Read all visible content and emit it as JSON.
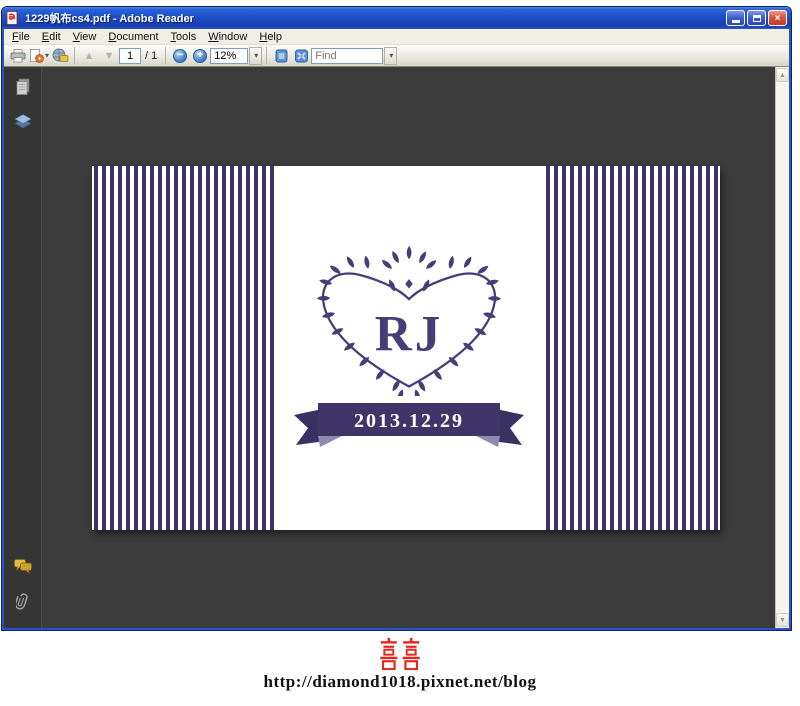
{
  "window": {
    "title": "1229帆布cs4.pdf - Adobe Reader",
    "controls": {
      "close_glyph": "×"
    }
  },
  "menu": {
    "items": [
      "File",
      "Edit",
      "View",
      "Document",
      "Tools",
      "Window",
      "Help"
    ]
  },
  "toolbar": {
    "page_value": "1",
    "page_total_label": "/ 1",
    "zoom_value": "12%",
    "find_placeholder": "Find",
    "prev_glyph": "▲",
    "next_glyph": "▼",
    "zoom_out_glyph": "−",
    "zoom_in_glyph": "+",
    "dropdown_glyph": "▾"
  },
  "scrollbar": {
    "up_glyph": "▲",
    "down_glyph": "▼"
  },
  "document": {
    "monogram": "RJ",
    "date": "2013.12.29"
  },
  "footer": {
    "symbol": "囍",
    "url": "http://diamond1018.pixnet.net/blog"
  },
  "colors": {
    "wreath_purple": "#473d79",
    "stripe_purple": "#3c3263",
    "ribbon_purple": "#3f3569",
    "ribbon_fold": "#8f8ab3",
    "happiness_red": "#e8241c",
    "titlebar_blue": "#1c4fc6",
    "doc_background": "#3b3b3b"
  }
}
